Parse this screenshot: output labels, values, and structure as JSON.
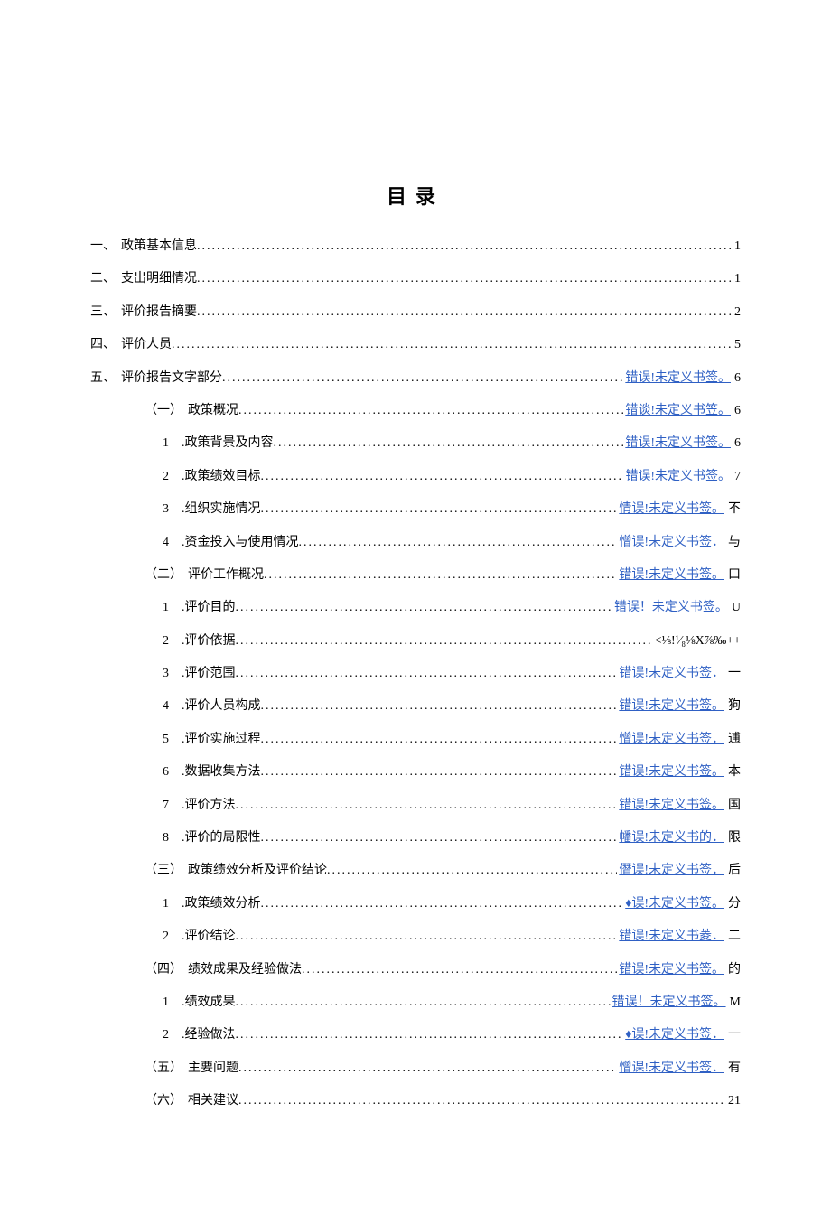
{
  "title": "目录",
  "dots": "..................................................................................................................................................................................",
  "entries": [
    {
      "level": 1,
      "num": "一、",
      "text": "政策基本信息",
      "sep": "",
      "link": "",
      "page": "1"
    },
    {
      "level": 1,
      "num": "二、",
      "text": "支出明细情况",
      "sep": "",
      "link": "",
      "page": "1"
    },
    {
      "level": 1,
      "num": "三、",
      "text": "评价报告摘要",
      "sep": "",
      "link": "",
      "page": "2"
    },
    {
      "level": 1,
      "num": "四、",
      "text": "评价人员",
      "sep": "",
      "link": "",
      "page": "5"
    },
    {
      "level": 1,
      "num": "五、",
      "text": "评价报告文字部分",
      "sep": "",
      "link": "错误!未定义书签。",
      "page": "6"
    },
    {
      "level": 2,
      "num": "（一）",
      "text": "政策概况",
      "sep": "",
      "link": "错谈!未定义书笠。",
      "page": "6"
    },
    {
      "level": 3,
      "num": "1",
      "text": ".政策背景及内容",
      "sep": " ",
      "link": "错误!未定义书签。",
      "page": "6"
    },
    {
      "level": 3,
      "num": "2",
      "text": ".政策绩效目标",
      "sep": "",
      "link": "错误!未定义书签。",
      "page": "7"
    },
    {
      "level": 3,
      "num": "3",
      "text": ".组织实施情况",
      "sep": "",
      "link": "情误!未定义书签。",
      "page": "不"
    },
    {
      "level": 3,
      "num": "4",
      "text": ".资金投入与使用情况",
      "sep": "",
      "link": "憎误!未定义书签．",
      "page": "与"
    },
    {
      "level": 2,
      "num": "（二）",
      "text": "评价工作概况",
      "sep": "",
      "link": "错误!未定义书签。",
      "page": "口"
    },
    {
      "level": 3,
      "num": "1",
      "text": ".评价目的",
      "sep": " ",
      "link": "错误！未定义书签。",
      "page": "U"
    },
    {
      "level": 3,
      "num": "2",
      "text": ".评价依据",
      "sep": " ",
      "link": "",
      "page": "<⅛!¹⁄₈⅛X⅞‰++"
    },
    {
      "level": 3,
      "num": "3",
      "text": ".评价范围",
      "sep": "",
      "link": "错误!未定义书签．",
      "page": "一"
    },
    {
      "level": 3,
      "num": "4",
      "text": ".评价人员构成",
      "sep": "",
      "link": "错误!未定义书签。",
      "page": "狗"
    },
    {
      "level": 3,
      "num": "5",
      "text": ".评价实施过程",
      "sep": "",
      "link": "憎误!未定义书签．",
      "page": "逋"
    },
    {
      "level": 3,
      "num": "6",
      "text": ".数据收集方法",
      "sep": "",
      "link": "错误!未定义书签。",
      "page": "本"
    },
    {
      "level": 3,
      "num": "7",
      "text": ".评价方法",
      "sep": "",
      "link": "错误!未定义书签。",
      "page": "国"
    },
    {
      "level": 3,
      "num": "8",
      "text": ".评价的局限性",
      "sep": "",
      "link": "幡误!未定义书的．",
      "page": "限"
    },
    {
      "level": 2,
      "num": "（三）",
      "text": "政策绩效分析及评价结论",
      "sep": "",
      "link": "僭误!未定义书签．",
      "page": "后"
    },
    {
      "level": 3,
      "num": "1",
      "text": ".政策绩效分析",
      "sep": "",
      "link": "♦误!未定义书签。",
      "page": "分"
    },
    {
      "level": 3,
      "num": "2",
      "text": ".评价结论",
      "sep": "",
      "link": "错误!未定义书菱．",
      "page": "二"
    },
    {
      "level": 2,
      "num": "（四）",
      "text": "绩效成果及经验做法",
      "sep": "",
      "link": "错误!未定义书签。",
      "page": "的"
    },
    {
      "level": 3,
      "num": "1",
      "text": ".绩效成果",
      "sep": " ",
      "link": "错误！未定义书签。",
      "page": "M"
    },
    {
      "level": 3,
      "num": "2",
      "text": ".经验做法",
      "sep": "",
      "link": "♦误!未定义书签．",
      "page": "一"
    },
    {
      "level": 2,
      "num": "（五）",
      "text": "主要问题",
      "sep": "",
      "link": "憎课!未定义书签．",
      "page": "有"
    },
    {
      "level": 2,
      "num": "（六）",
      "text": "相关建议",
      "sep": "",
      "link": "",
      "page": "21"
    }
  ]
}
